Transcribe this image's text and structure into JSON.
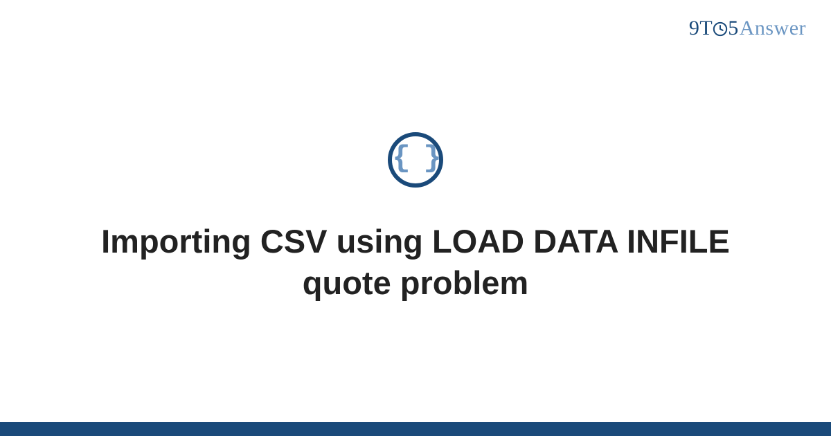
{
  "brand": {
    "part1": "9",
    "part2": "T",
    "part3": "5",
    "part4": "Answer"
  },
  "icon": {
    "name": "code-braces-icon",
    "glyph": "{ }"
  },
  "title": "Importing CSV using LOAD DATA INFILE quote problem",
  "colors": {
    "primary": "#1a4a7a",
    "secondary": "#6a95c2",
    "text": "#222222",
    "background": "#ffffff"
  }
}
